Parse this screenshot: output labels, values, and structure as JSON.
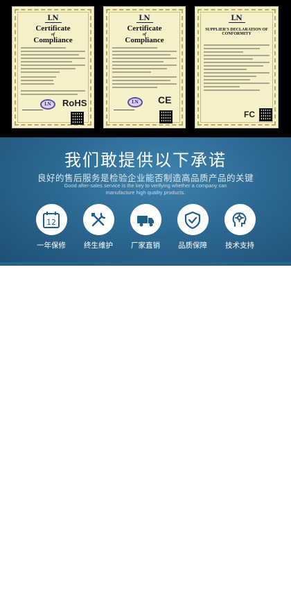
{
  "certificates": [
    {
      "logo": "LN",
      "title_line1": "Certificate",
      "title_of": "of",
      "title_line2": "Compliance",
      "mark": "RoHS",
      "mark_icon": "rohs-mark"
    },
    {
      "logo": "LN",
      "title_line1": "Certificate",
      "title_of": "of",
      "title_line2": "Compliance",
      "mark": "CE",
      "mark_icon": "ce-mark"
    },
    {
      "logo": "LN",
      "title_line1": "SUPPLIER'S DECLARATION OF",
      "title_of": "",
      "title_line2": "CONFORMITY",
      "mark": "FC",
      "mark_icon": "fcc-mark"
    }
  ],
  "promise": {
    "title": "我们敢提供以下承诺",
    "subtitle": "良好的售后服务是检验企业能否制造高品质产品的关键",
    "english_line1": "Good after-sales service is the key to verifying whether a company can",
    "english_line2": "manufacture high quality products.",
    "services": [
      {
        "label": "一年保修",
        "icon": "calendar-12-icon"
      },
      {
        "label": "终生维护",
        "icon": "tools-icon"
      },
      {
        "label": "厂家直销",
        "icon": "delivery-truck-icon"
      },
      {
        "label": "品质保障",
        "icon": "shield-check-icon"
      },
      {
        "label": "技术支持",
        "icon": "tech-support-head-icon"
      }
    ]
  },
  "colors": {
    "band_blue": "#2c6a93",
    "certificate_paper": "#f5f0c8",
    "icon_circle": "#ffffff"
  }
}
